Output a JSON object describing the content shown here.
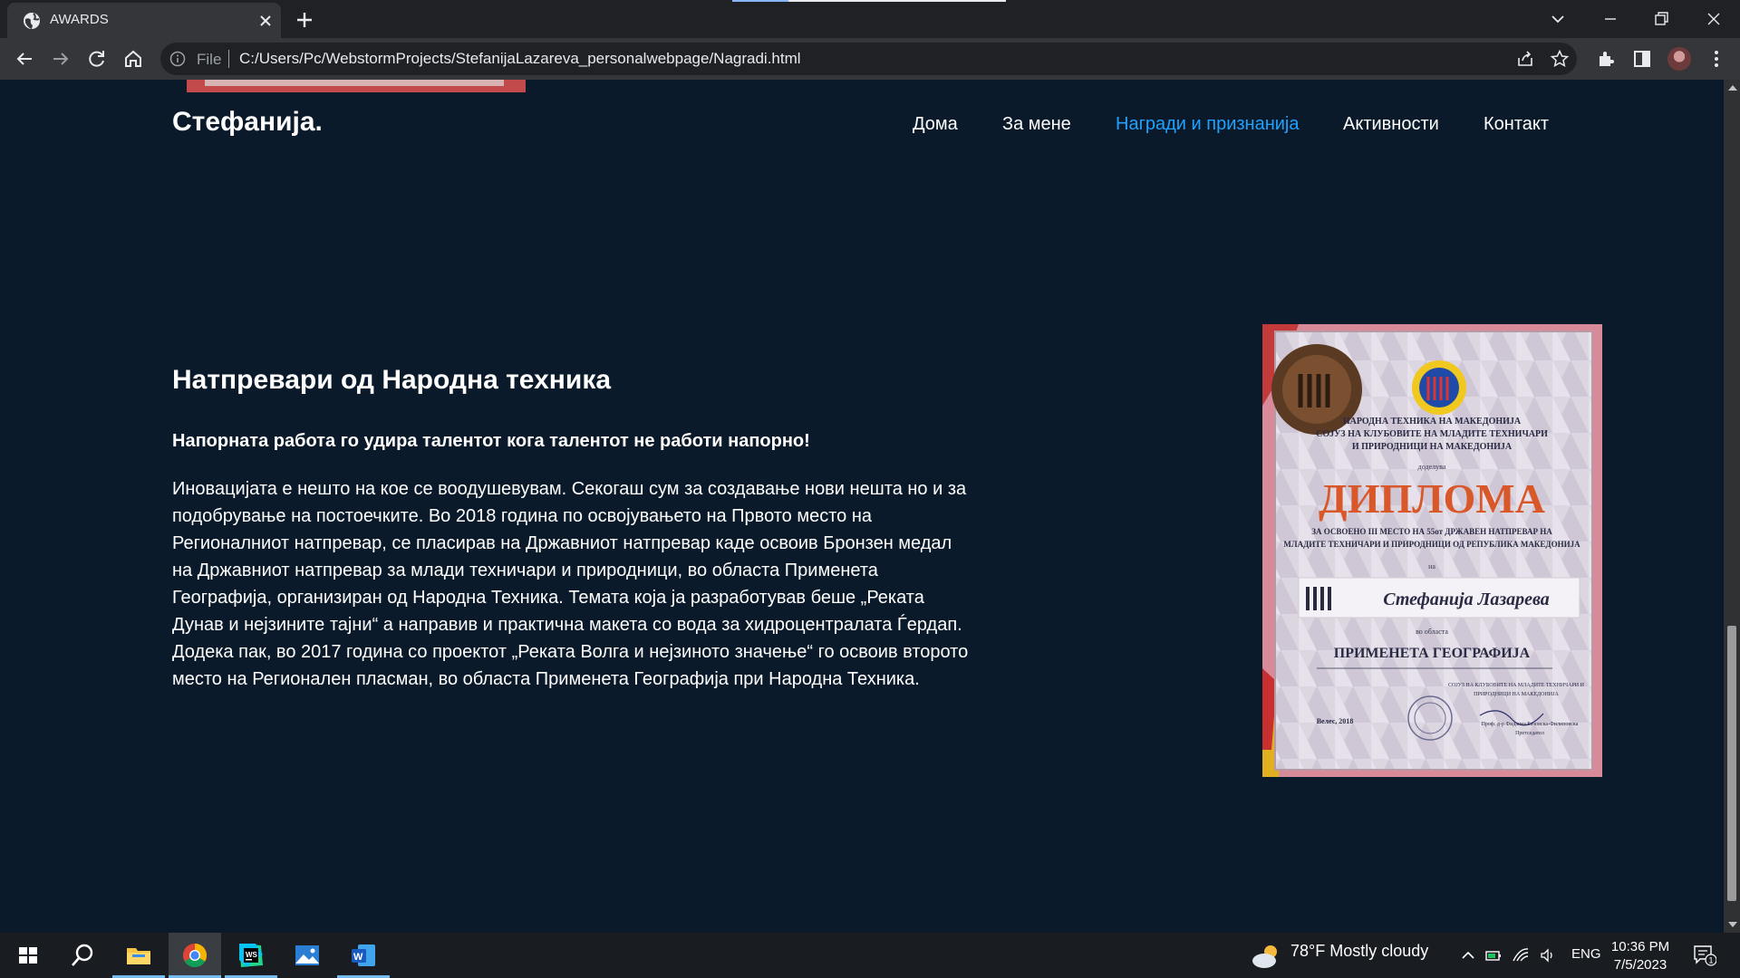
{
  "browser": {
    "tab_title": "AWARDS",
    "url_scheme": "File",
    "url": "C:/Users/Pc/WebstormProjects/StefanijaLazareva_personalwebpage/Nagradi.html"
  },
  "site": {
    "brand": "Стефанија.",
    "nav": [
      {
        "label": "Дома"
      },
      {
        "label": "За мене"
      },
      {
        "label": "Награди и признанија",
        "active": true
      },
      {
        "label": "Активности"
      },
      {
        "label": "Контакт"
      }
    ]
  },
  "content": {
    "heading": "Натпревари од Народна техника",
    "motto": "Напорната работа го удира талентот кога талентот не работи напорно!",
    "paragraph": "Иновацијата е нешто на кое се воодушевувам. Секогаш сум за создавање нови нешта но и за подобрување на постоечките. Во 2018 година по освојувањето на Првото место на Регионалниот натпревар, се пласирав на Државниот натпревар каде освоив Бронзен медал на Државниот натпревар за млади техничари и природници, во областа Применета Географија, организиран од Народна Техника. Темата која ја разработував беше „Реката Дунав и нејзините тајни“ а направив и практична макета со вода за хидроцентралата Ѓердап. Додека пак, во 2017 година со проектот „Реката Волга и нејзиното значење“ го освоив второто место на Регионален пласман, во областа Применета Географија при Народна Техника.",
    "diploma": {
      "org_lines": [
        "НАРОДНА ТЕХНИКА НА МАКЕДОНИЈА",
        "СОЈУЗ НА КЛУБОВИТЕ НА МЛАДИТЕ ТЕХНИЧАРИ",
        "И ПРИРОДНИЦИ НА МАКЕДОНИЈА"
      ],
      "dodeluva": "доделува",
      "title": "ДИПЛОМА",
      "award_lines": [
        "ЗА ОСВОЕНО III МЕСТО НА 55от ДРЖАВЕН НАТПРЕВАР НА",
        "МЛАДИТЕ ТЕХНИЧАРИ И ПРИРОДНИЦИ ОД РЕПУБЛИКА МАКЕДОНИЈА"
      ],
      "na": "на",
      "name": "Стефанија Лазарева",
      "vo_oblasta": "во областа",
      "field": "ПРИМЕНЕТА ГЕОГРАФИЈА",
      "footer_org": [
        "СОЈУЗ НА КЛУБОВИТЕ НА МЛАДИТЕ ТЕХНИЧАРИ И",
        "ПРИРОДНИЦИ НА МАКЕДОНИЈА"
      ],
      "place_date": "Велес, 2018",
      "signatory": [
        "Проф. д-р Фиданка Бачовска-Филиповска",
        "Претседател"
      ]
    }
  },
  "taskbar": {
    "weather_text": "78°F  Mostly cloudy",
    "language": "ENG",
    "time": "10:36 PM",
    "date": "7/5/2023",
    "notification_count": "1"
  }
}
